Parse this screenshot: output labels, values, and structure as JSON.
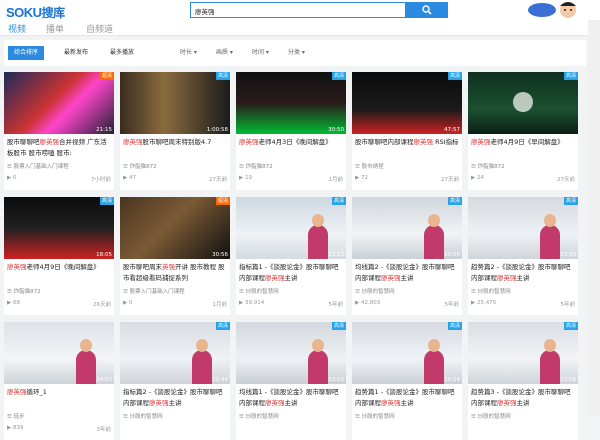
{
  "logo": {
    "brand": "SOKU",
    "cn": "搜库"
  },
  "search": {
    "value": "廖英强"
  },
  "tabs": [
    {
      "label": "视频"
    },
    {
      "label": "播单"
    },
    {
      "label": "自频道"
    }
  ],
  "filters": {
    "sort": [
      "综合排序",
      "最新发布",
      "最多播放"
    ],
    "dropdowns": [
      "时长",
      "画质",
      "时间",
      "分类"
    ]
  },
  "cards": [
    {
      "title_pre": "股市聊聊吧",
      "hl": "廖英强",
      "title_post": "合并视频 广东活板股市 股市唠嗑 股市:",
      "badge": "超清",
      "badge_color": "#ff6a00",
      "dur": "21:15",
      "uploader": "股票入门基础入门课程",
      "plays": "0",
      "time": "7小时前"
    },
    {
      "title_pre": "",
      "hl": "廖英强",
      "title_post": "股市聊吧周末特别版4.7",
      "badge": "高清",
      "badge_color": "#29a3e8",
      "dur": "1:00:58",
      "uploader": "炸脂猫872",
      "plays": "47",
      "time": "27天前"
    },
    {
      "title_pre": "",
      "hl": "廖英强",
      "title_post": "老师4月3日《晚间解盘》",
      "badge": "高清",
      "badge_color": "#29a3e8",
      "dur": "30:50",
      "uploader": "炸脂猫872",
      "plays": "19",
      "time": "1月前"
    },
    {
      "title_pre": "股市聊聊吧内部课程",
      "hl": "廖英强",
      "title_post": " RSI指标",
      "badge": "高清",
      "badge_color": "#29a3e8",
      "dur": "47:57",
      "uploader": "股市绣捏",
      "plays": "72",
      "time": "27天前"
    },
    {
      "title_pre": "",
      "hl": "廖英强",
      "title_post": "老师4月9日《早间解盘》",
      "badge": "高清",
      "badge_color": "#29a3e8",
      "dur": "",
      "uploader": "炸脂猫872",
      "plays": "24",
      "time": "27天前"
    },
    {
      "title_pre": "",
      "hl": "廖英强",
      "title_post": "老师4月9日《晚间解盘》",
      "badge": "高清",
      "badge_color": "#29a3e8",
      "dur": "18:05",
      "uploader": "炸脂猫872",
      "plays": "68",
      "time": "26天前"
    },
    {
      "title_pre": "股市聊吧周末",
      "hl": "英强",
      "title_post": "开讲 股市教程 股市看超级看码捕捉系列",
      "badge": "超清",
      "badge_color": "#ff6a00",
      "dur": "30:56",
      "uploader": "股票入门基础入门课程",
      "plays": "0",
      "time": "1月前"
    },
    {
      "title_pre": "指标篇1 -《談股论金》股市聊聊吧内部课程",
      "hl": "廖英强",
      "title_post": "主讲",
      "badge": "高清",
      "badge_color": "#29a3e8",
      "dur": "23:13",
      "uploader": "炒股的智慧网",
      "plays": "39,914",
      "time": "5年前"
    },
    {
      "title_pre": "均线篇2 -《談股论金》股市聊聊吧内部课程",
      "hl": "廖英强",
      "title_post": "主讲",
      "badge": "高清",
      "badge_color": "#29a3e8",
      "dur": "25:55",
      "uploader": "炒股的智慧网",
      "plays": "42,803",
      "time": "5年前"
    },
    {
      "title_pre": "趋势篇2 -《談股论金》股市聊聊吧内部课程",
      "hl": "廖英强",
      "title_post": "主讲",
      "badge": "高清",
      "badge_color": "#29a3e8",
      "dur": "23:39",
      "uploader": "炒股的智慧网",
      "plays": "25,475",
      "time": "5年前"
    },
    {
      "title_pre": "",
      "hl": "廖英强",
      "title_post": "循环_1",
      "badge": "",
      "badge_color": "",
      "dur": "24:53",
      "uploader": "徒步",
      "plays": "839",
      "time": "3年前"
    },
    {
      "title_pre": "指标篇2 -《談股论金》股市聊聊吧内部课程",
      "hl": "廖英强",
      "title_post": "主讲",
      "badge": "高清",
      "badge_color": "#29a3e8",
      "dur": "21:44",
      "uploader": "炒股的智慧网",
      "plays": "",
      "time": ""
    },
    {
      "title_pre": "均线篇1 -《談股论金》股市聊聊吧内部课程",
      "hl": "廖英强",
      "title_post": "主讲",
      "badge": "高清",
      "badge_color": "#29a3e8",
      "dur": "23:53",
      "uploader": "炒股的智慧网",
      "plays": "",
      "time": ""
    },
    {
      "title_pre": "趋势篇1 -《談股论金》股市聊聊吧内部课程",
      "hl": "廖英强",
      "title_post": "主讲",
      "badge": "高清",
      "badge_color": "#29a3e8",
      "dur": "20:14",
      "uploader": "炒股的智慧网",
      "plays": "",
      "time": ""
    },
    {
      "title_pre": "趋势篇3 -《談股论金》股市聊聊吧内部课程",
      "hl": "廖英强",
      "title_post": "主讲",
      "badge": "高清",
      "badge_color": "#29a3e8",
      "dur": "23:58",
      "uploader": "炒股的智慧网",
      "plays": "",
      "time": ""
    }
  ]
}
